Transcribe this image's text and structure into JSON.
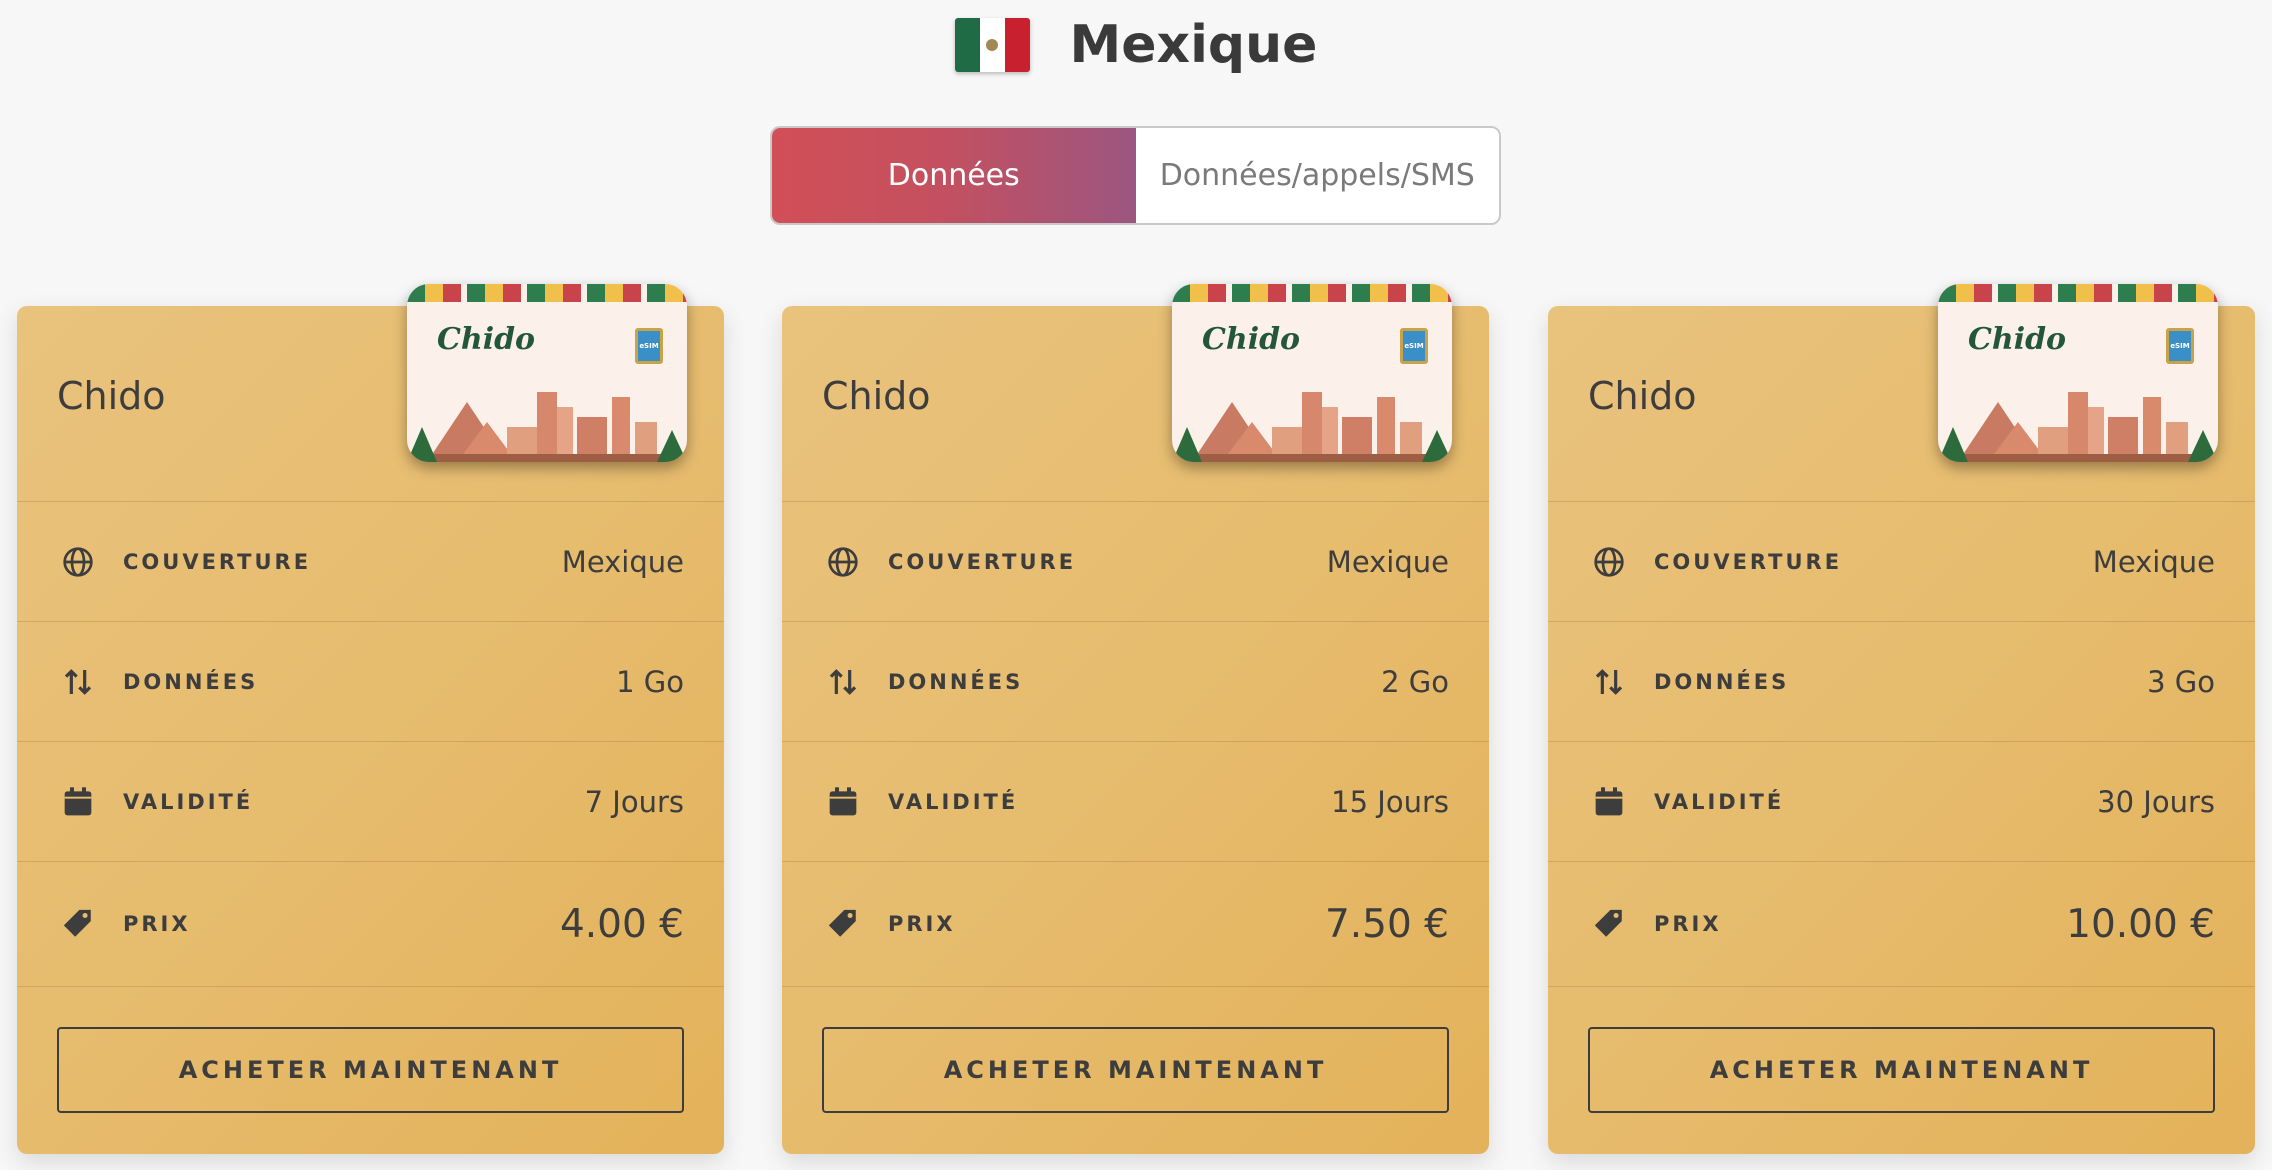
{
  "header": {
    "country": "Mexique",
    "flag_icon": "mexico-flag-icon"
  },
  "tabs": [
    {
      "label": "Données",
      "active": true
    },
    {
      "label": "Données/appels/SMS",
      "active": false
    }
  ],
  "labels": {
    "coverage": "COUVERTURE",
    "data": "DONNÉES",
    "validity": "VALIDITÉ",
    "price": "PRIX",
    "buy": "ACHETER MAINTENANT"
  },
  "card_image": {
    "brand": "Chido",
    "chip": "eSIM"
  },
  "plans": [
    {
      "name": "Chido",
      "coverage": "Mexique",
      "data": "1 Go",
      "validity": "7 Jours",
      "price": "4.00 €"
    },
    {
      "name": "Chido",
      "coverage": "Mexique",
      "data": "2 Go",
      "validity": "15 Jours",
      "price": "7.50 €"
    },
    {
      "name": "Chido",
      "coverage": "Mexique",
      "data": "3 Go",
      "validity": "30 Jours",
      "price": "10.00 €"
    }
  ],
  "colors": {
    "card": "#e6bb6c",
    "tab_active_start": "#d14f57",
    "tab_active_end": "#9c5680",
    "text": "#3d3d3d"
  }
}
